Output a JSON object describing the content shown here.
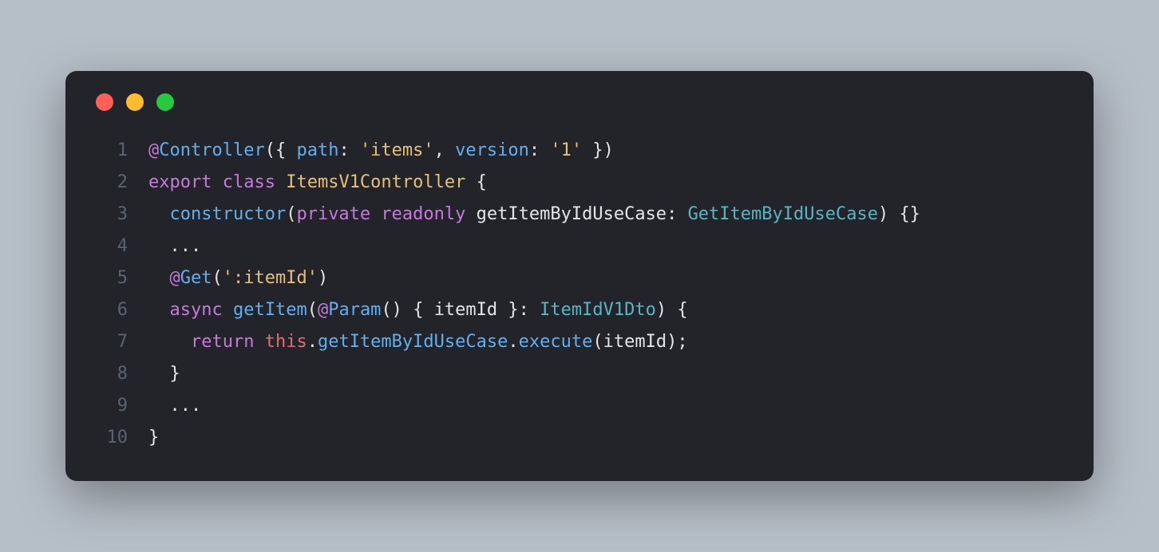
{
  "window": {
    "traffic_lights": [
      "close",
      "minimize",
      "maximize"
    ]
  },
  "code": {
    "line_numbers": [
      "1",
      "2",
      "3",
      "4",
      "5",
      "6",
      "7",
      "8",
      "9",
      "10"
    ],
    "tokens": {
      "l1": {
        "at1": "@",
        "controller": "Controller",
        "open_paren": "(",
        "open_brace": "{ ",
        "path_key": "path",
        "colon1": ": ",
        "path_val": "'items'",
        "comma": ", ",
        "version_key": "version",
        "colon2": ": ",
        "version_val": "'1'",
        "close": " })"
      },
      "l2": {
        "export": "export",
        "sp1": " ",
        "class": "class",
        "sp2": " ",
        "name": "ItemsV1Controller",
        "sp3": " ",
        "brace": "{"
      },
      "l3": {
        "indent": "  ",
        "constructor": "constructor",
        "open": "(",
        "private": "private",
        "sp1": " ",
        "readonly": "readonly",
        "sp2": " ",
        "param": "getItemByIdUseCase",
        "colon": ": ",
        "type": "GetItemByIdUseCase",
        "close": ") {}"
      },
      "l4": {
        "indent": "  ",
        "dots": "..."
      },
      "l5": {
        "indent": "  ",
        "at": "@",
        "get": "Get",
        "open": "(",
        "arg": "':itemId'",
        "close": ")"
      },
      "l6": {
        "indent": "  ",
        "async": "async",
        "sp1": " ",
        "method": "getItem",
        "open": "(",
        "at": "@",
        "param_dec": "Param",
        "paren": "() ",
        "destruct_open": "{ ",
        "itemid": "itemId",
        "destruct_close": " }",
        "colon": ": ",
        "type": "ItemIdV1Dto",
        "close": ") {"
      },
      "l7": {
        "indent": "    ",
        "return": "return",
        "sp": " ",
        "this": "this",
        "dot1": ".",
        "prop": "getItemByIdUseCase",
        "dot2": ".",
        "execute": "execute",
        "open": "(",
        "arg": "itemId",
        "close": ");"
      },
      "l8": {
        "indent": "  ",
        "brace": "}"
      },
      "l9": {
        "indent": "  ",
        "dots": "..."
      },
      "l10": {
        "brace": "}"
      }
    }
  }
}
